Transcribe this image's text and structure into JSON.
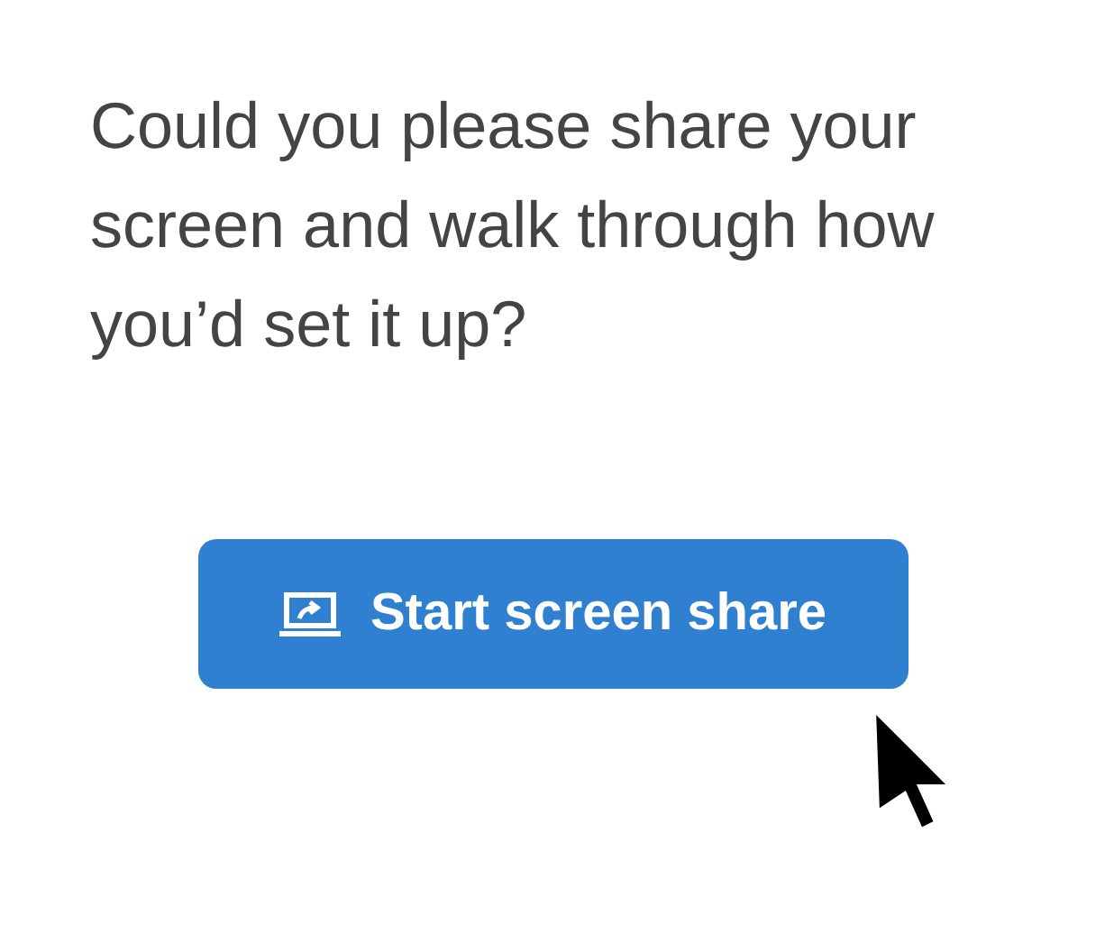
{
  "prompt": "Could you please share your screen and walk through how you’d set it up?",
  "button": {
    "label": "Start screen share"
  }
}
